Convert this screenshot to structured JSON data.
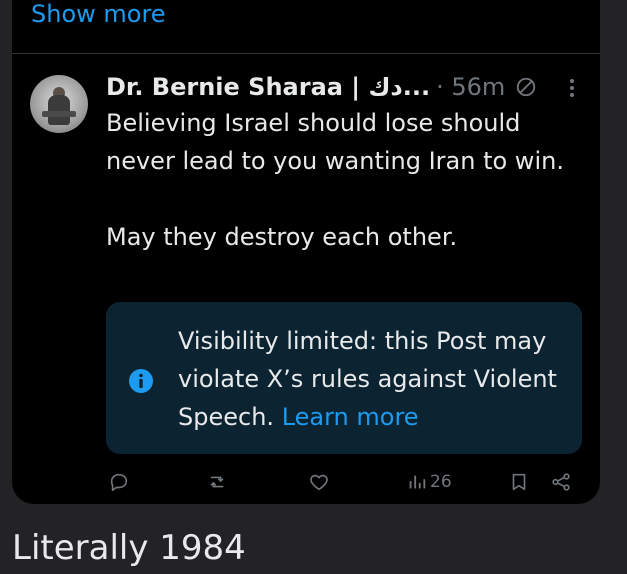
{
  "thread": {
    "show_more_label": "Show more"
  },
  "post": {
    "author_name": "Dr. Bernie Sharaa | دك...",
    "timestamp": "· 56m",
    "paragraph1": "Believing Israel should lose should never lead to you wanting Iran to win.",
    "paragraph2": "May they destroy each other.",
    "notice": {
      "text": "Visibility limited: this Post may violate X’s rules against Violent Speech.",
      "link": "Learn more"
    },
    "views_count": "26",
    "icons": {
      "visibility": "no-symbol-icon",
      "more": "more-dots-icon",
      "info": "info-icon",
      "reply": "reply-icon",
      "repost": "repost-icon",
      "like": "heart-icon",
      "views": "views-icon",
      "bookmark": "bookmark-icon",
      "share": "share-icon"
    }
  },
  "footer": {
    "caption": "Literally 1984"
  },
  "colors": {
    "accent": "#1d9bf0",
    "background_outer": "#232325",
    "card_background": "#000000",
    "notice_background": "#0c2331",
    "muted_text": "#71767b",
    "primary_text": "#e7e9ea"
  }
}
